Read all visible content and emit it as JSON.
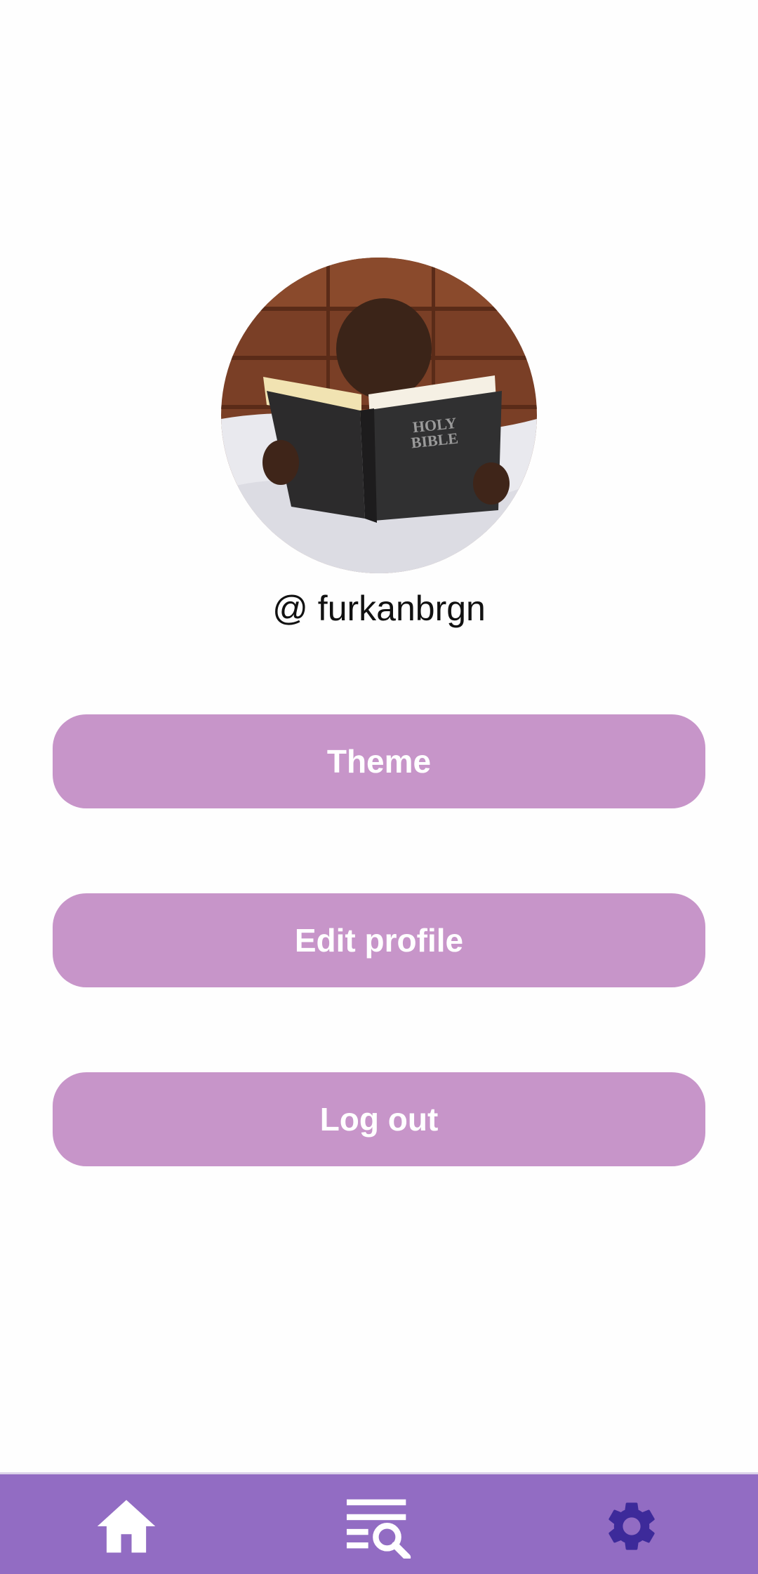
{
  "profile": {
    "username": "@ furkanbrgn",
    "avatar_text": "HOLY BIBLE"
  },
  "menu": {
    "theme_label": "Theme",
    "edit_profile_label": "Edit profile",
    "logout_label": "Log out"
  },
  "bottom_nav": {
    "items": [
      {
        "icon": "home-icon",
        "active": false
      },
      {
        "icon": "list-search-icon",
        "active": false
      },
      {
        "icon": "gear-icon",
        "active": true
      }
    ],
    "background_color": "#926cc3",
    "icon_color": "#ffffff",
    "active_icon_color": "#3d2a9a"
  },
  "colors": {
    "button_background": "#c795c9",
    "button_text": "#ffffff"
  }
}
